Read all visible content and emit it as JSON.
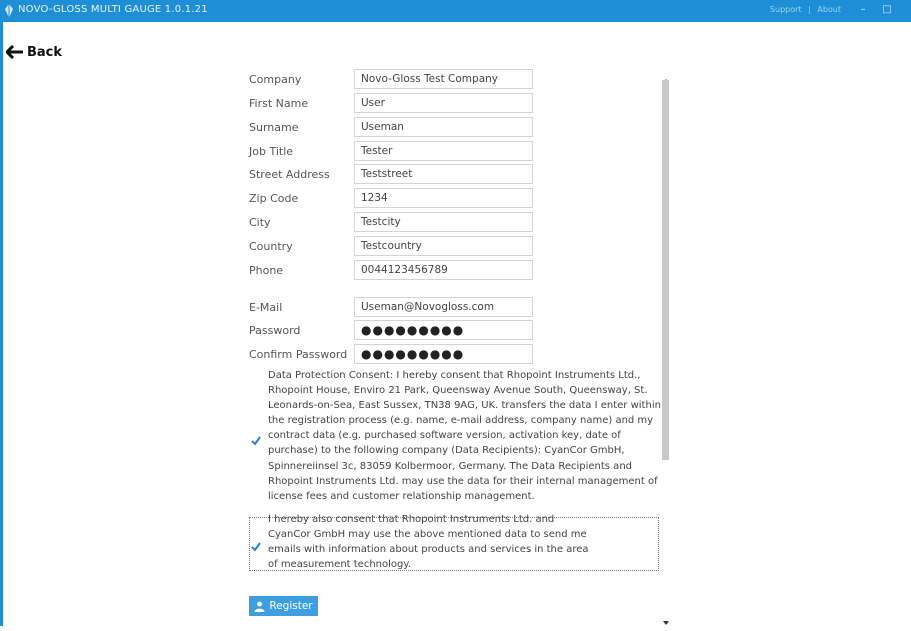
{
  "window": {
    "title": "NOVO-GLOSS MULTI GAUGE 1.0.1.21",
    "support_label": "Support",
    "about_label": "About",
    "minimize_symbol": "–",
    "maximize_symbol": "□"
  },
  "nav": {
    "back_label": "Back"
  },
  "form": {
    "fields": [
      {
        "label": "Company",
        "value": "Novo-Gloss Test Company"
      },
      {
        "label": "First Name",
        "value": "User"
      },
      {
        "label": "Surname",
        "value": "Useman"
      },
      {
        "label": "Job Title",
        "value": "Tester"
      },
      {
        "label": "Street Address",
        "value": "Teststreet"
      },
      {
        "label": "Zip Code",
        "value": "1234"
      },
      {
        "label": "City",
        "value": "Testcity"
      },
      {
        "label": "Country",
        "value": "Testcountry"
      },
      {
        "label": "Phone",
        "value": "0044123456789"
      },
      {
        "label": "E-Mail",
        "value": "Useman@Novogloss.com"
      },
      {
        "label": "Password",
        "value": "●●●●●●●●●"
      },
      {
        "label": "Confirm Password",
        "value": "●●●●●●●●●"
      }
    ]
  },
  "consent": {
    "data_protection_text": "Data Protection Consent: I hereby consent that Rhopoint Instruments Ltd., Rhopoint House, Enviro 21 Park, Queensway Avenue South, Queensway, St. Leonards-on-Sea, East Sussex, TN38 9AG, UK. transfers the data I enter within the registration process (e.g. name, e-mail address, company name) and my contract data (e.g. purchased software version, activation key, date of purchase) to the following company (Data Recipients): CyanCor GmbH, Spinnereiinsel 3c, 83059 Kolbermoor, Germany. The Data Recipients and Rhopoint Instruments Ltd. may use the data for their internal management of license fees and customer relationship management.",
    "data_protection_checked": true,
    "marketing_text": "I hereby also consent that Rhopoint Instruments Ltd. and CyanCor GmbH may use the above mentioned data to send me emails with information about products and services in the area of measurement technology.",
    "marketing_checked": true
  },
  "actions": {
    "register_label": "Register"
  },
  "colors": {
    "titlebar": "#1e8fd6",
    "accent": "#3d9ee0",
    "check": "#2a7fd0"
  }
}
